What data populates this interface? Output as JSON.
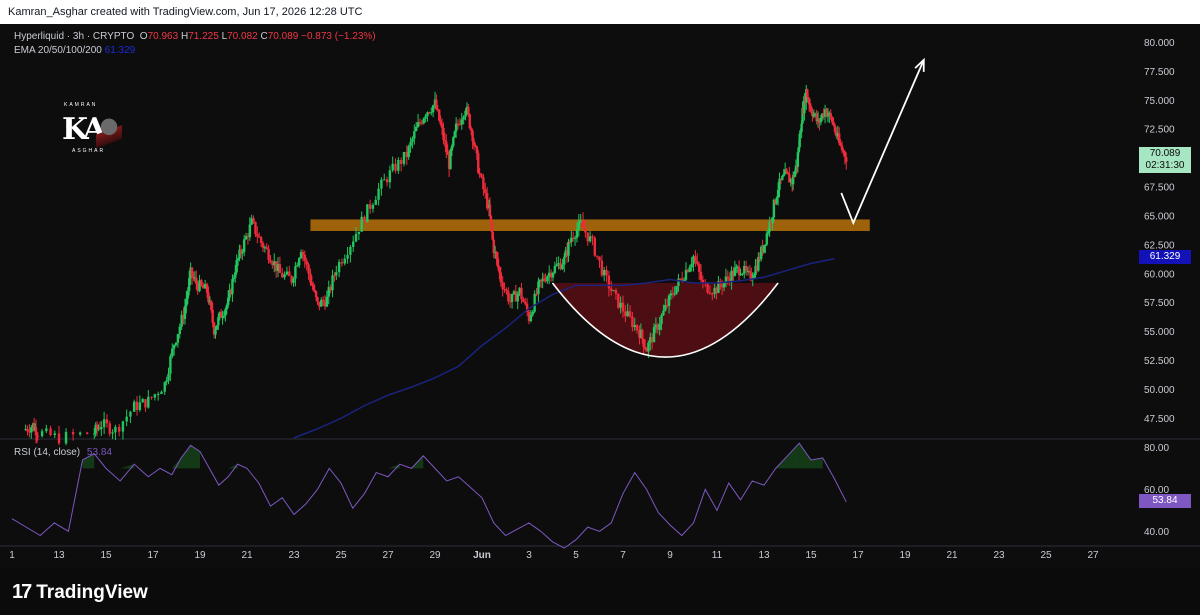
{
  "header": {
    "attribution": "Kamran_Asghar created with TradingView.com, Jun 17, 2026 12:28 UTC"
  },
  "legend": {
    "symbol": "Hyperliquid · 3h · CRYPTO",
    "o_label": "O",
    "o_value": "70.963",
    "h_label": "H",
    "h_value": "71.225",
    "l_label": "L",
    "l_value": "70.082",
    "c_label": "C",
    "c_value": "70.089",
    "change": "−0.873 (−1.23%)",
    "ema_label": "EMA 20/50/100/200",
    "ema_value": "61.329"
  },
  "logo": {
    "letters": "KA",
    "top_text": "KAMRAN",
    "bottom_text": "ASGHAR"
  },
  "price_tags": {
    "last_price": "70.089",
    "countdown": "02:31:30",
    "ema_price": "61.329",
    "rsi_value": "53.84"
  },
  "rsi": {
    "label": "RSI (14, close)",
    "value": "53.84"
  },
  "footer": {
    "brand": "TradingView",
    "brand_mark": "17"
  },
  "colors": {
    "bull": "#26a69a",
    "bull_candle": "#22c55e",
    "bear": "#ef2b3b",
    "ema": "#1a237e",
    "resistance": "#b8730b",
    "cup_fill": "#5c0f14",
    "rsi_line": "#7e57c2",
    "last_price_bg": "#a6e6c2"
  },
  "chart_data": [
    {
      "type": "candlestick",
      "title": "",
      "x_ticks": [
        "1",
        "13",
        "15",
        "17",
        "19",
        "21",
        "23",
        "25",
        "27",
        "29",
        "Jun",
        "3",
        "5",
        "7",
        "9",
        "11",
        "13",
        "15",
        "17",
        "19",
        "21",
        "23",
        "25",
        "27"
      ],
      "y_ticks": [
        "80.000",
        "77.500",
        "75.000",
        "72.500",
        "70.000",
        "67.500",
        "65.000",
        "62.500",
        "60.000",
        "57.500",
        "55.000",
        "52.500",
        "50.000",
        "47.500"
      ],
      "ylim": [
        45.8,
        81.6
      ],
      "close_path": [
        {
          "x": 0.5,
          "y": 46.5
        },
        {
          "x": 0.9,
          "y": 46.9
        },
        {
          "x": 1.1,
          "y": 46.3
        },
        {
          "x": 2.0,
          "y": 45.8
        },
        {
          "x": 3.5,
          "y": 46.3
        },
        {
          "x": 3.8,
          "y": 47.0
        },
        {
          "x": 4.4,
          "y": 46.5
        },
        {
          "x": 5.2,
          "y": 48.5
        },
        {
          "x": 5.8,
          "y": 49.0
        },
        {
          "x": 6.5,
          "y": 50.5
        },
        {
          "x": 6.9,
          "y": 54.0
        },
        {
          "x": 7.3,
          "y": 56.5
        },
        {
          "x": 7.6,
          "y": 60.0
        },
        {
          "x": 7.9,
          "y": 59.0
        },
        {
          "x": 8.3,
          "y": 58.5
        },
        {
          "x": 8.6,
          "y": 55.2
        },
        {
          "x": 8.9,
          "y": 56.5
        },
        {
          "x": 9.2,
          "y": 57.5
        },
        {
          "x": 9.5,
          "y": 60.5
        },
        {
          "x": 9.8,
          "y": 62.3
        },
        {
          "x": 10.2,
          "y": 64.4
        },
        {
          "x": 10.6,
          "y": 62.7
        },
        {
          "x": 11.0,
          "y": 61.5
        },
        {
          "x": 11.4,
          "y": 60.0
        },
        {
          "x": 11.9,
          "y": 59.5
        },
        {
          "x": 12.3,
          "y": 62.3
        },
        {
          "x": 12.7,
          "y": 59.5
        },
        {
          "x": 13.0,
          "y": 57.3
        },
        {
          "x": 13.4,
          "y": 57.8
        },
        {
          "x": 13.8,
          "y": 60.5
        },
        {
          "x": 14.4,
          "y": 62.6
        },
        {
          "x": 15.0,
          "y": 65.0
        },
        {
          "x": 15.6,
          "y": 67.3
        },
        {
          "x": 16.2,
          "y": 69.0
        },
        {
          "x": 16.8,
          "y": 70.3
        },
        {
          "x": 17.2,
          "y": 72.5
        },
        {
          "x": 17.6,
          "y": 74.0
        },
        {
          "x": 18.0,
          "y": 74.7
        },
        {
          "x": 18.3,
          "y": 72.3
        },
        {
          "x": 18.6,
          "y": 69.5
        },
        {
          "x": 18.9,
          "y": 72.6
        },
        {
          "x": 19.3,
          "y": 74.5
        },
        {
          "x": 19.6,
          "y": 72.0
        },
        {
          "x": 19.9,
          "y": 68.5
        },
        {
          "x": 20.3,
          "y": 65.5
        },
        {
          "x": 20.5,
          "y": 62.2
        },
        {
          "x": 20.8,
          "y": 59.5
        },
        {
          "x": 21.2,
          "y": 57.6
        },
        {
          "x": 21.6,
          "y": 58.5
        },
        {
          "x": 22.0,
          "y": 56.2
        },
        {
          "x": 22.4,
          "y": 58.8
        },
        {
          "x": 22.7,
          "y": 59.8
        },
        {
          "x": 23.1,
          "y": 60.5
        },
        {
          "x": 23.5,
          "y": 61.2
        },
        {
          "x": 23.8,
          "y": 63.2
        },
        {
          "x": 24.2,
          "y": 64.3
        },
        {
          "x": 24.7,
          "y": 62.6
        },
        {
          "x": 25.2,
          "y": 59.8
        },
        {
          "x": 25.7,
          "y": 57.8
        },
        {
          "x": 26.2,
          "y": 56.3
        },
        {
          "x": 26.7,
          "y": 55.0
        },
        {
          "x": 27.0,
          "y": 53.5
        },
        {
          "x": 27.4,
          "y": 55.2
        },
        {
          "x": 27.8,
          "y": 57.0
        },
        {
          "x": 28.2,
          "y": 58.7
        },
        {
          "x": 28.6,
          "y": 60.0
        },
        {
          "x": 29.0,
          "y": 61.5
        },
        {
          "x": 29.4,
          "y": 59.0
        },
        {
          "x": 29.9,
          "y": 58.6
        },
        {
          "x": 30.3,
          "y": 59.3
        },
        {
          "x": 30.7,
          "y": 60.1
        },
        {
          "x": 31.0,
          "y": 60.5
        },
        {
          "x": 31.4,
          "y": 59.6
        },
        {
          "x": 31.7,
          "y": 60.8
        },
        {
          "x": 32.0,
          "y": 62.6
        },
        {
          "x": 32.3,
          "y": 64.8
        },
        {
          "x": 32.6,
          "y": 67.5
        },
        {
          "x": 32.9,
          "y": 68.5
        },
        {
          "x": 33.2,
          "y": 68.0
        },
        {
          "x": 33.4,
          "y": 69.5
        },
        {
          "x": 33.6,
          "y": 73.5
        },
        {
          "x": 33.8,
          "y": 75.8
        },
        {
          "x": 34.0,
          "y": 74.3
        },
        {
          "x": 34.3,
          "y": 73.0
        },
        {
          "x": 34.6,
          "y": 74.2
        },
        {
          "x": 34.9,
          "y": 73.2
        },
        {
          "x": 35.2,
          "y": 71.2
        },
        {
          "x": 35.5,
          "y": 70.1
        }
      ],
      "ema_path": [
        {
          "x": 12.0,
          "y": 45.8
        },
        {
          "x": 13.0,
          "y": 46.6
        },
        {
          "x": 14.0,
          "y": 47.5
        },
        {
          "x": 15.0,
          "y": 48.6
        },
        {
          "x": 16.0,
          "y": 49.5
        },
        {
          "x": 17.0,
          "y": 50.2
        },
        {
          "x": 18.0,
          "y": 51.0
        },
        {
          "x": 19.0,
          "y": 52.0
        },
        {
          "x": 20.0,
          "y": 53.8
        },
        {
          "x": 21.0,
          "y": 55.3
        },
        {
          "x": 22.0,
          "y": 57.0
        },
        {
          "x": 23.0,
          "y": 58.2
        },
        {
          "x": 24.0,
          "y": 59.0
        },
        {
          "x": 25.0,
          "y": 59.0
        },
        {
          "x": 26.0,
          "y": 59.0
        },
        {
          "x": 27.0,
          "y": 59.2
        },
        {
          "x": 28.0,
          "y": 59.5
        },
        {
          "x": 29.0,
          "y": 59.2
        },
        {
          "x": 30.0,
          "y": 59.2
        },
        {
          "x": 31.0,
          "y": 59.4
        },
        {
          "x": 32.0,
          "y": 59.7
        },
        {
          "x": 33.0,
          "y": 60.3
        },
        {
          "x": 34.0,
          "y": 60.9
        },
        {
          "x": 35.0,
          "y": 61.3
        }
      ],
      "resistance_zone": {
        "x_start": 12.7,
        "x_end": 36.5,
        "y_low": 63.7,
        "y_high": 64.7
      },
      "cup": {
        "x_start": 23.0,
        "x_end": 32.6,
        "rim": 59.2,
        "bottom": 52.8
      },
      "projection_arrow": [
        {
          "x": 35.8,
          "y": 64.4
        },
        {
          "x": 38.8,
          "y": 78.5
        }
      ]
    },
    {
      "type": "line",
      "title": "",
      "series_label": "RSI (14, close)",
      "y_ticks": [
        "80.00",
        "60.00",
        "40.00"
      ],
      "ylim": [
        33,
        84
      ],
      "values": [
        {
          "x": 0.0,
          "y": 46
        },
        {
          "x": 0.6,
          "y": 42
        },
        {
          "x": 1.2,
          "y": 38
        },
        {
          "x": 1.8,
          "y": 44
        },
        {
          "x": 2.4,
          "y": 40
        },
        {
          "x": 3.0,
          "y": 74
        },
        {
          "x": 3.5,
          "y": 77
        },
        {
          "x": 4.0,
          "y": 70
        },
        {
          "x": 4.6,
          "y": 64
        },
        {
          "x": 5.2,
          "y": 72
        },
        {
          "x": 5.8,
          "y": 66
        },
        {
          "x": 6.3,
          "y": 70
        },
        {
          "x": 6.8,
          "y": 67
        },
        {
          "x": 7.2,
          "y": 75
        },
        {
          "x": 7.6,
          "y": 81
        },
        {
          "x": 8.0,
          "y": 78
        },
        {
          "x": 8.4,
          "y": 70
        },
        {
          "x": 8.8,
          "y": 62
        },
        {
          "x": 9.2,
          "y": 66
        },
        {
          "x": 9.6,
          "y": 72
        },
        {
          "x": 10.0,
          "y": 70
        },
        {
          "x": 10.5,
          "y": 63
        },
        {
          "x": 11.0,
          "y": 52
        },
        {
          "x": 11.5,
          "y": 56
        },
        {
          "x": 12.0,
          "y": 48
        },
        {
          "x": 12.5,
          "y": 53
        },
        {
          "x": 13.0,
          "y": 60
        },
        {
          "x": 13.5,
          "y": 70
        },
        {
          "x": 14.0,
          "y": 63
        },
        {
          "x": 14.5,
          "y": 51
        },
        {
          "x": 15.0,
          "y": 58
        },
        {
          "x": 15.5,
          "y": 68
        },
        {
          "x": 16.0,
          "y": 66
        },
        {
          "x": 16.5,
          "y": 72
        },
        {
          "x": 17.0,
          "y": 70
        },
        {
          "x": 17.5,
          "y": 76
        },
        {
          "x": 18.0,
          "y": 70
        },
        {
          "x": 18.5,
          "y": 64
        },
        {
          "x": 19.0,
          "y": 66
        },
        {
          "x": 19.5,
          "y": 61
        },
        {
          "x": 20.0,
          "y": 56
        },
        {
          "x": 20.5,
          "y": 44
        },
        {
          "x": 21.0,
          "y": 38
        },
        {
          "x": 21.5,
          "y": 41
        },
        {
          "x": 22.0,
          "y": 44
        },
        {
          "x": 22.5,
          "y": 40
        },
        {
          "x": 23.0,
          "y": 35
        },
        {
          "x": 23.5,
          "y": 32
        },
        {
          "x": 24.0,
          "y": 36
        },
        {
          "x": 24.5,
          "y": 42
        },
        {
          "x": 25.0,
          "y": 40
        },
        {
          "x": 25.5,
          "y": 44
        },
        {
          "x": 26.0,
          "y": 58
        },
        {
          "x": 26.5,
          "y": 68
        },
        {
          "x": 27.0,
          "y": 60
        },
        {
          "x": 27.5,
          "y": 49
        },
        {
          "x": 28.0,
          "y": 43
        },
        {
          "x": 28.5,
          "y": 38
        },
        {
          "x": 29.0,
          "y": 44
        },
        {
          "x": 29.5,
          "y": 60
        },
        {
          "x": 30.0,
          "y": 50
        },
        {
          "x": 30.5,
          "y": 63
        },
        {
          "x": 31.0,
          "y": 55
        },
        {
          "x": 31.5,
          "y": 64
        },
        {
          "x": 32.0,
          "y": 62
        },
        {
          "x": 32.5,
          "y": 70
        },
        {
          "x": 33.0,
          "y": 76
        },
        {
          "x": 33.5,
          "y": 82
        },
        {
          "x": 34.0,
          "y": 74
        },
        {
          "x": 34.5,
          "y": 75
        },
        {
          "x": 35.0,
          "y": 65
        },
        {
          "x": 35.5,
          "y": 54
        }
      ]
    }
  ]
}
